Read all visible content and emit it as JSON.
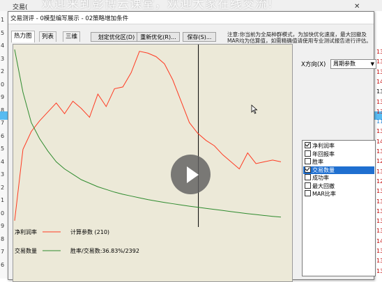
{
  "watermark": "欢迎来到彭博云课堂，欢迎大家在线交流!",
  "app": {
    "menu_trade": "交易(",
    "close_glyph": "✕",
    "left_numbers": [
      "1",
      "5",
      "4",
      "3",
      "2",
      "0",
      "9",
      "8",
      "7",
      "6",
      "5",
      "4",
      "3",
      "2",
      "1",
      "0",
      "9",
      "8",
      "7",
      "6"
    ],
    "right_numbers": [
      "13",
      "13",
      "13",
      "14",
      "13",
      "13",
      "13",
      "11",
      "13",
      "14",
      "13",
      "12",
      "13",
      "12",
      "13",
      "13",
      "13",
      "13",
      "13",
      "14",
      "13",
      "13",
      "13"
    ]
  },
  "dialog": {
    "title": "交易测评 - 0模型编写展示 - 02策略增加条件"
  },
  "tabs": [
    "热力图",
    "列表",
    "三维"
  ],
  "toolbar": {
    "set_region": "划定优化区(D)",
    "reoptimize": "重新优化(R)...",
    "save": "保存(S)..."
  },
  "notice": "注意:你当前为全局种群模式，为加快优化速度，最大回撤及MAR均为估算值，如需精确值请使用专业测试报告进行评估。",
  "xdirection": {
    "label": "X方向(X)",
    "value": "周期参数"
  },
  "metrics": [
    {
      "label": "净利润率",
      "checked": true,
      "selected": false
    },
    {
      "label": "年回报率",
      "checked": false,
      "selected": false
    },
    {
      "label": "胜率",
      "checked": false,
      "selected": false
    },
    {
      "label": "交易数量",
      "checked": true,
      "selected": true
    },
    {
      "label": "成功率",
      "checked": false,
      "selected": false
    },
    {
      "label": "最大回撤",
      "checked": false,
      "selected": false
    },
    {
      "label": "MAR比率",
      "checked": false,
      "selected": false
    }
  ],
  "legend": {
    "series1_name": "净利润率",
    "series1_info": "计算参数 (210)",
    "series2_name": "交易数量",
    "series2_info": "胜率/交易数:36.83%/2392"
  },
  "colors": {
    "profit_line": "#ff3a22",
    "trades_line": "#2e8b2e",
    "plot_bg": "#ece9d8",
    "cursor_line": "#000000",
    "selected_item": "#1f6fd0"
  },
  "chart_data": {
    "type": "line",
    "x_param": "周期参数",
    "series": [
      {
        "name": "净利润率",
        "values": [
          0.02,
          0.42,
          0.52,
          0.58,
          0.63,
          0.68,
          0.62,
          0.69,
          0.65,
          0.6,
          0.73,
          0.66,
          0.76,
          0.77,
          0.85,
          0.97,
          0.96,
          0.94,
          0.9,
          0.81,
          0.69,
          0.57,
          0.51,
          0.47,
          0.44,
          0.39,
          0.35,
          0.31,
          0.4,
          0.34,
          0.35,
          0.36,
          0.35
        ]
      },
      {
        "name": "交易数量",
        "values": [
          0.98,
          0.74,
          0.57,
          0.48,
          0.41,
          0.35,
          0.31,
          0.28,
          0.25,
          0.23,
          0.21,
          0.195,
          0.18,
          0.168,
          0.158,
          0.148,
          0.138,
          0.13,
          0.122,
          0.115,
          0.108,
          0.101,
          0.095,
          0.089,
          0.083,
          0.077,
          0.071,
          0.065,
          0.059,
          0.054,
          0.049,
          0.044,
          0.04
        ]
      }
    ],
    "cursor_x_fraction": 0.69,
    "grid": false
  }
}
